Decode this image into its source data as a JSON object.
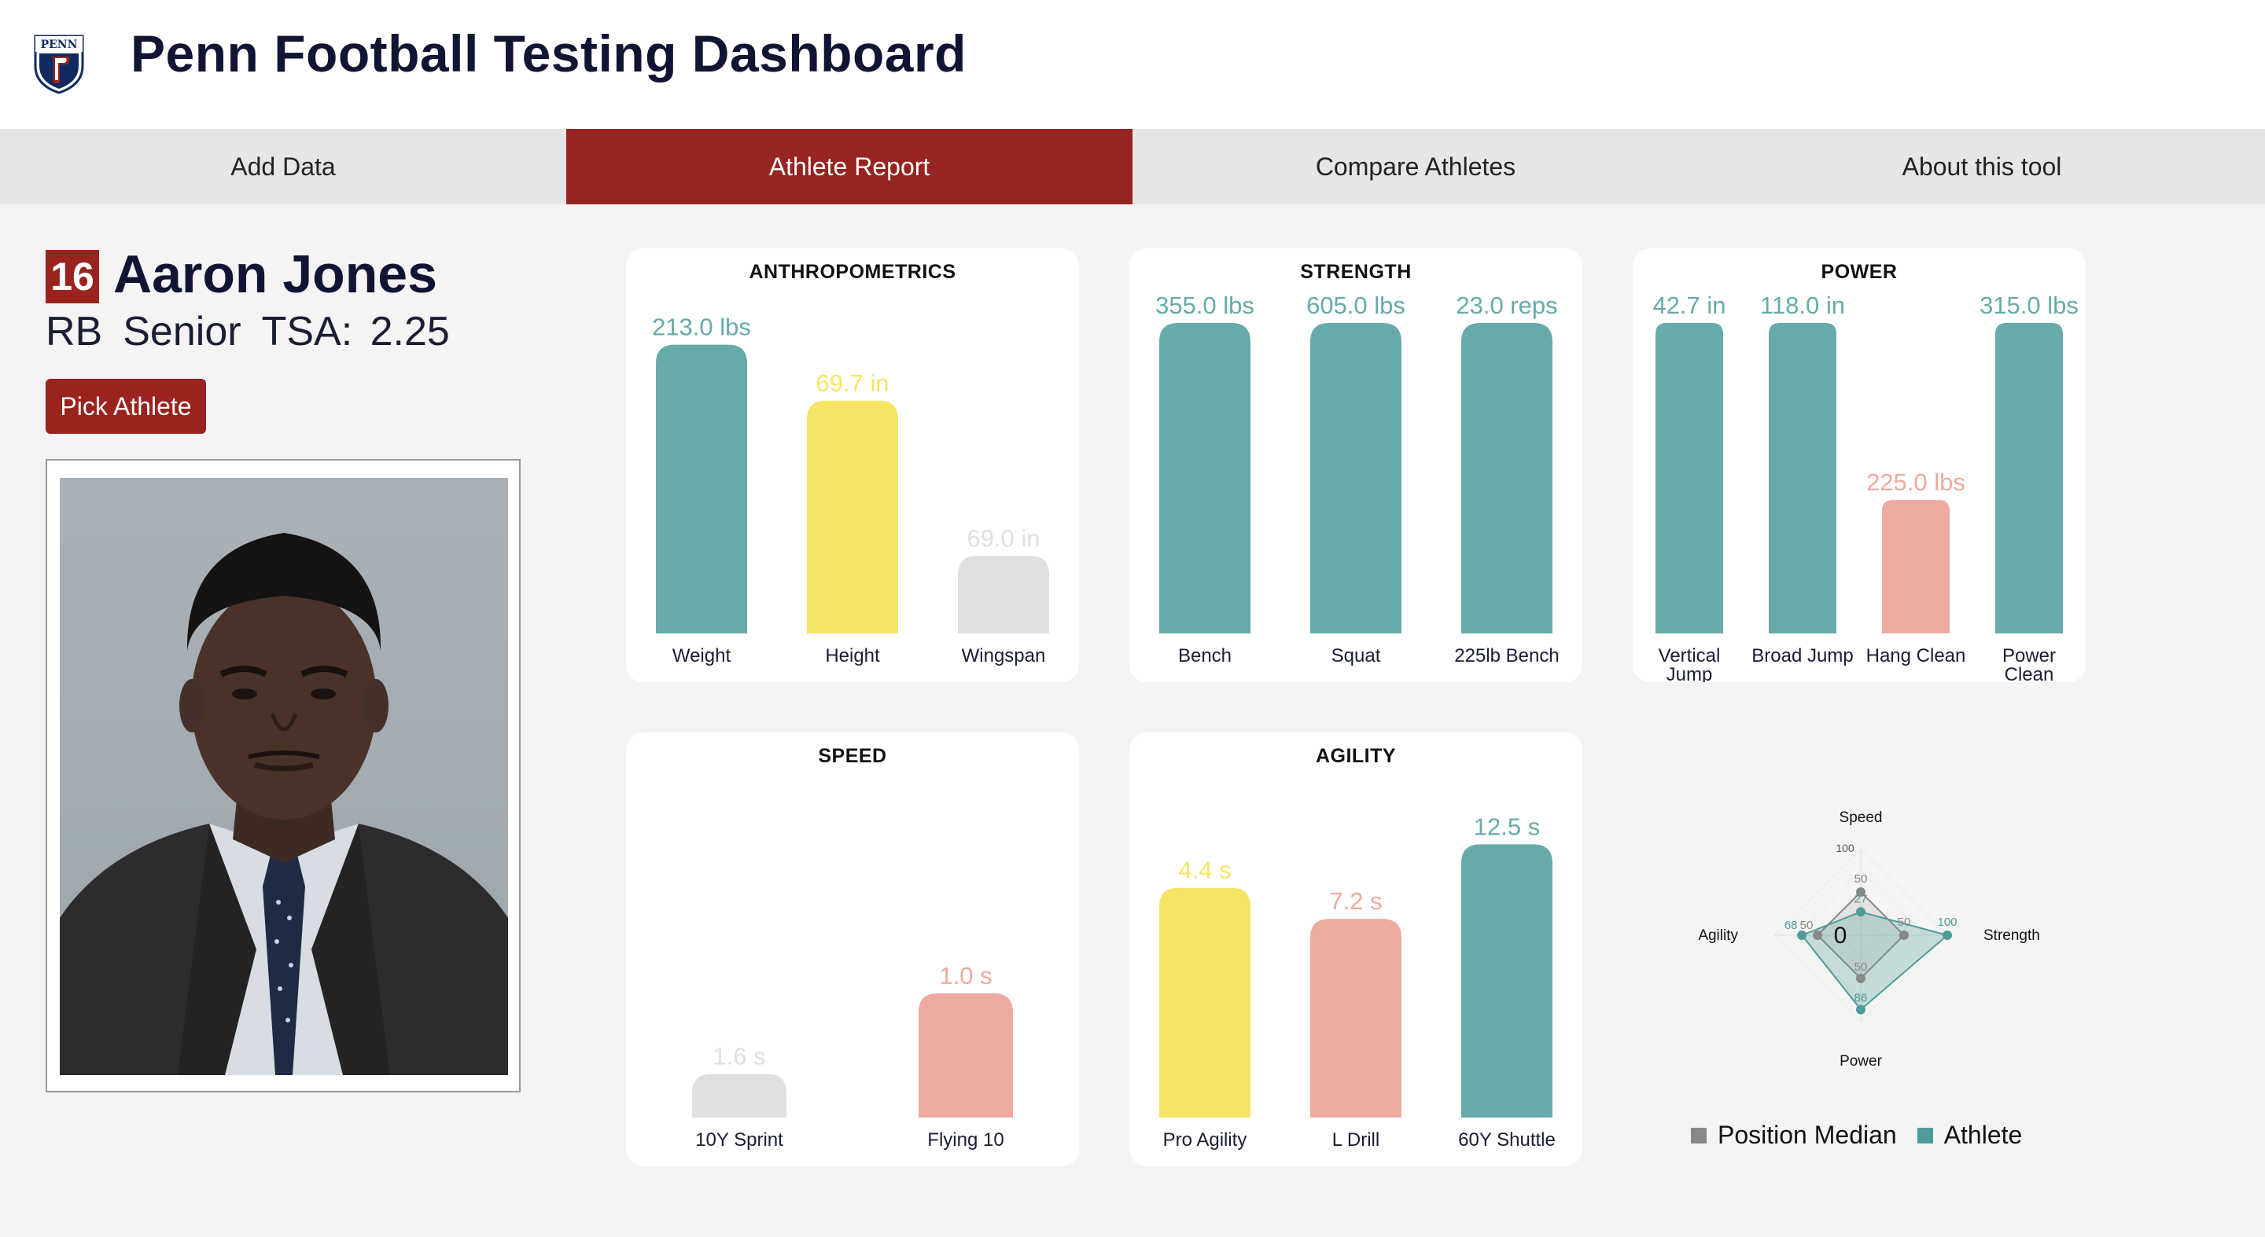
{
  "app": {
    "title": "Penn Football Testing Dashboard",
    "logo_text": "PENN"
  },
  "nav": {
    "tabs": [
      {
        "label": "Add Data",
        "active": false
      },
      {
        "label": "Athlete Report",
        "active": true
      },
      {
        "label": "Compare Athletes",
        "active": false
      },
      {
        "label": "About this tool",
        "active": false
      }
    ]
  },
  "athlete": {
    "number": "16",
    "name": "Aaron Jones",
    "position": "RB",
    "class_year": "Senior",
    "tsa": "TSA: 2.25",
    "pick_button": "Pick Athlete"
  },
  "colors": {
    "teal": "#66aba9",
    "yellow": "#f7e466",
    "gray": "#e0e0e0",
    "salmon": "#eeaaa0",
    "brand_red": "#962421"
  },
  "chart_data": [
    {
      "type": "bar",
      "title": "ANTHROPOMETRICS",
      "categories": [
        "Weight",
        "Height",
        "Wingspan"
      ],
      "values": [
        213.0,
        69.7,
        69.0
      ],
      "value_labels": [
        "213.0 lbs",
        "69.7 in",
        "69.0 in"
      ],
      "bar_levels": [
        0.93,
        0.75,
        0.25
      ],
      "colors": [
        "teal",
        "yellow",
        "gray"
      ]
    },
    {
      "type": "bar",
      "title": "STRENGTH",
      "categories": [
        "Bench",
        "Squat",
        "225lb Bench"
      ],
      "values": [
        355.0,
        605.0,
        23.0
      ],
      "value_labels": [
        "355.0 lbs",
        "605.0 lbs",
        "23.0 reps"
      ],
      "bar_levels": [
        1.0,
        1.0,
        1.0
      ],
      "colors": [
        "teal",
        "teal",
        "teal"
      ]
    },
    {
      "type": "bar",
      "title": "POWER",
      "categories": [
        [
          "Vertical",
          "Jump"
        ],
        [
          "Broad Jump"
        ],
        [
          "Hang Clean"
        ],
        [
          "Power",
          "Clean"
        ]
      ],
      "values": [
        42.7,
        118.0,
        225.0,
        315.0
      ],
      "value_labels": [
        "42.7 in",
        "118.0 in",
        "225.0 lbs",
        "315.0 lbs"
      ],
      "bar_levels": [
        1.0,
        1.0,
        0.43,
        1.0
      ],
      "colors": [
        "teal",
        "teal",
        "salmon",
        "teal"
      ]
    },
    {
      "type": "bar",
      "title": "SPEED",
      "categories": [
        "10Y Sprint",
        "Flying 10"
      ],
      "values": [
        1.6,
        1.0
      ],
      "value_labels": [
        "1.6 s",
        "1.0 s"
      ],
      "bar_levels": [
        0.14,
        0.4
      ],
      "colors": [
        "gray",
        "salmon"
      ]
    },
    {
      "type": "bar",
      "title": "AGILITY",
      "categories": [
        "Pro Agility",
        "L Drill",
        "60Y Shuttle"
      ],
      "values": [
        4.4,
        7.2,
        12.5
      ],
      "value_labels": [
        "4.4 s",
        "7.2 s",
        "12.5 s"
      ],
      "bar_levels": [
        0.74,
        0.64,
        0.88
      ],
      "colors": [
        "yellow",
        "salmon",
        "teal"
      ]
    },
    {
      "type": "radar",
      "axes": [
        "Speed",
        "Strength",
        "Power",
        "Agility"
      ],
      "max_tick": "100",
      "center_label": "0",
      "series": [
        {
          "name": "Position Median",
          "values": [
            50,
            50,
            50,
            50
          ],
          "labels": [
            "50",
            "50",
            "50",
            "50"
          ],
          "color": "#888888"
        },
        {
          "name": "Athlete",
          "values": [
            27,
            100,
            86,
            68
          ],
          "labels": [
            "27",
            "100",
            "86",
            "68"
          ],
          "color": "#4e9c97"
        }
      ]
    }
  ]
}
